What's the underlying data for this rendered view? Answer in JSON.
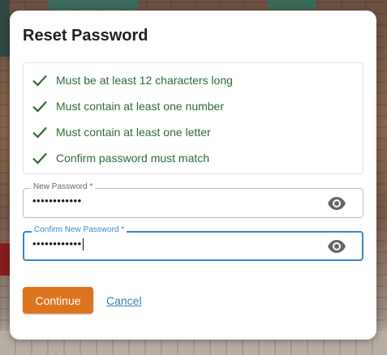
{
  "dialog": {
    "title": "Reset Password",
    "requirements": [
      {
        "label": "Must be at least 12 characters long",
        "met": true
      },
      {
        "label": "Must contain at least one number",
        "met": true
      },
      {
        "label": "Must contain at least one letter",
        "met": true
      },
      {
        "label": "Confirm password must match",
        "met": true
      }
    ],
    "new_password": {
      "label": "New Password *",
      "value": "••••••••••••"
    },
    "confirm_password": {
      "label": "Confirm New Password *",
      "value": "••••••••••••"
    },
    "continue_label": "Continue",
    "cancel_label": "Cancel"
  },
  "icons": {
    "check": "check-icon",
    "eye": "eye-icon"
  },
  "colors": {
    "check_green": "#2e6b35",
    "accent_orange": "#dd7420",
    "focus_blue": "#3a86c4",
    "link_blue": "#3a7fb8"
  }
}
